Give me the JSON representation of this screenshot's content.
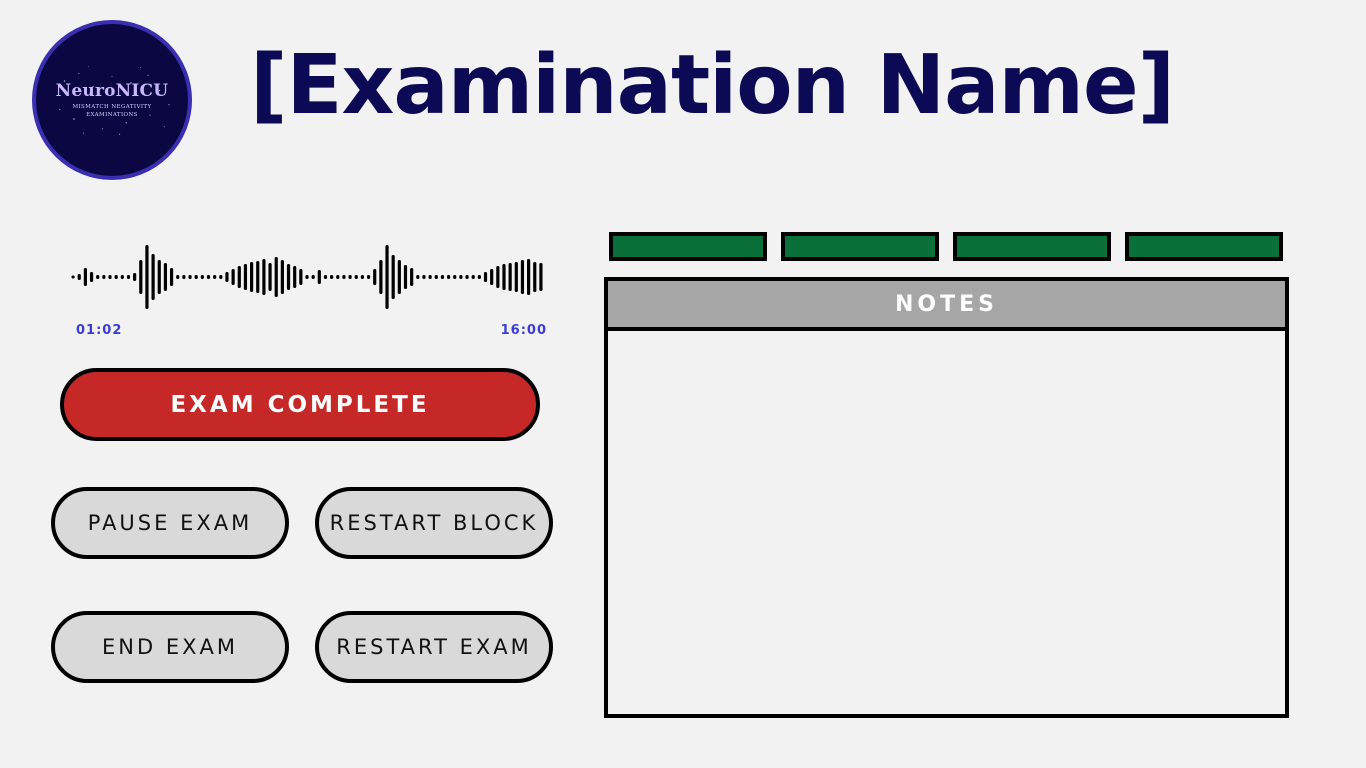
{
  "logo": {
    "name": "NeuroNICU",
    "subtitle_line1": "MISMATCH NEGATIVITY",
    "subtitle_line2": "EXAMINATIONS"
  },
  "title": "[Examination Name]",
  "audio": {
    "elapsed": "01:02",
    "total": "16:00"
  },
  "buttons": {
    "exam_complete": "EXAM COMPLETE",
    "pause_exam": "PAUSE EXAM",
    "restart_block": "RESTART BLOCK",
    "end_exam": "END EXAM",
    "restart_exam": "RESTART EXAM"
  },
  "notes": {
    "header": "NOTES",
    "body": ""
  },
  "tabs": [
    {
      "label": ""
    },
    {
      "label": ""
    },
    {
      "label": ""
    },
    {
      "label": ""
    }
  ],
  "colors": {
    "background": "#f2f2f2",
    "title": "#0d0a55",
    "logo_bg": "#0b0742",
    "exam_complete": "#c62828",
    "secondary_button": "#d9d9d9",
    "tab": "#087038",
    "notes_header": "#a6a6a6",
    "time_text": "#3b3bd8"
  }
}
